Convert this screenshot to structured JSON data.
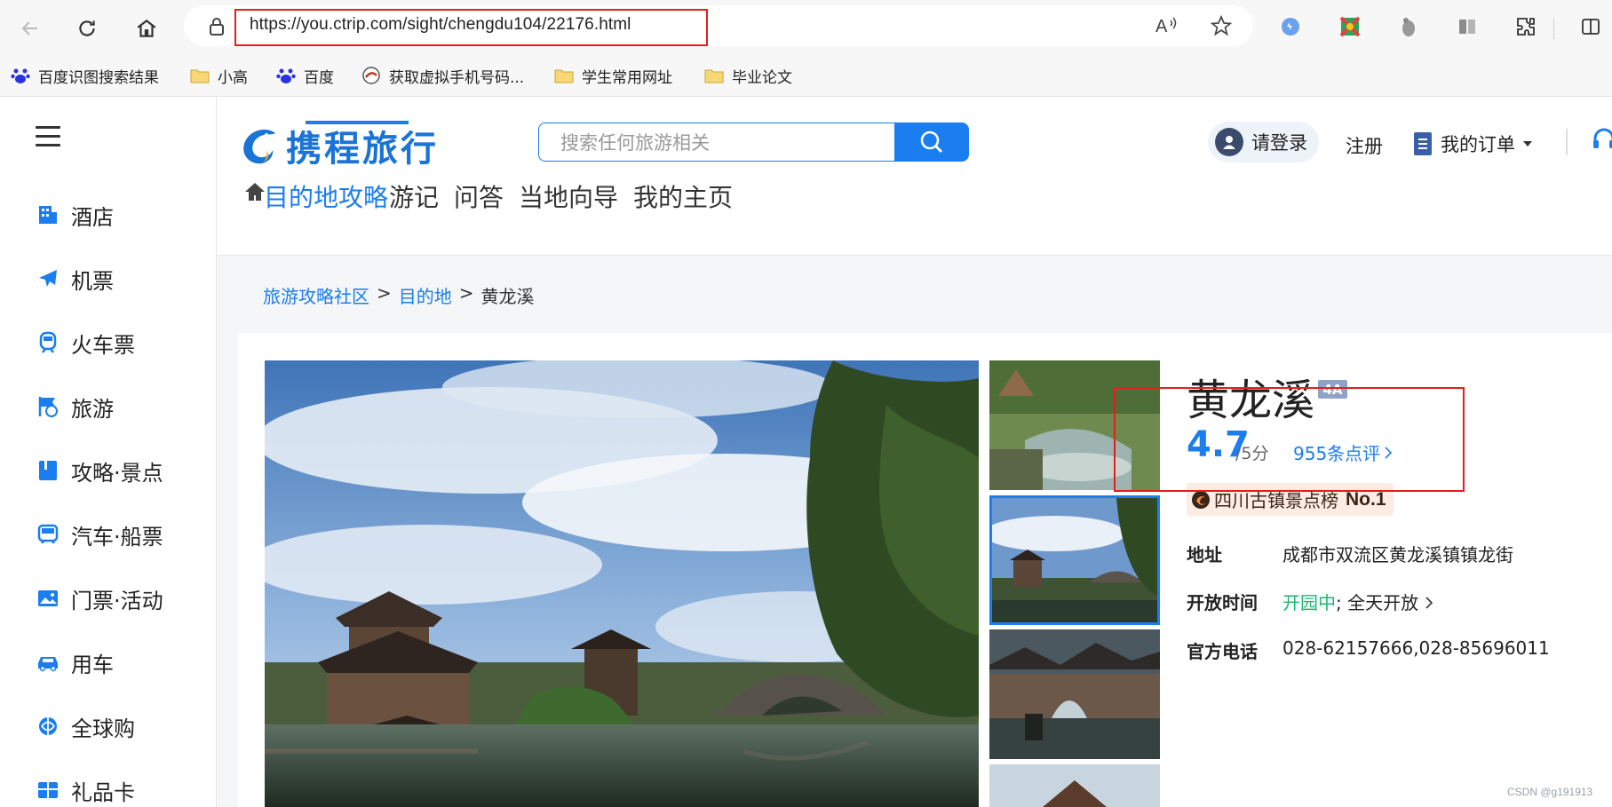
{
  "browser": {
    "url": "https://you.ctrip.com/sight/chengdu104/22176.html",
    "bookmarks": [
      {
        "label": "百度识图搜索结果",
        "icon": "baidu-paw-icon"
      },
      {
        "label": "小高",
        "icon": "folder-icon"
      },
      {
        "label": "百度",
        "icon": "baidu-paw-icon"
      },
      {
        "label": "获取虚拟手机号码...",
        "icon": "site-favicon-icon"
      },
      {
        "label": "学生常用网址",
        "icon": "folder-icon"
      },
      {
        "label": "毕业论文",
        "icon": "folder-icon"
      }
    ]
  },
  "sidebar": {
    "items": [
      {
        "label": "酒店",
        "icon": "hotel-icon"
      },
      {
        "label": "机票",
        "icon": "plane-icon"
      },
      {
        "label": "火车票",
        "icon": "train-icon"
      },
      {
        "label": "旅游",
        "icon": "travel-icon"
      },
      {
        "label": "攻略·景点",
        "icon": "guide-book-icon"
      },
      {
        "label": "汽车·船票",
        "icon": "bus-icon"
      },
      {
        "label": "门票·活动",
        "icon": "ticket-image-icon"
      },
      {
        "label": "用车",
        "icon": "car-icon"
      },
      {
        "label": "全球购",
        "icon": "global-shop-icon"
      },
      {
        "label": "礼品卡",
        "icon": "gift-card-icon"
      }
    ]
  },
  "header": {
    "logo_text": "携程旅行",
    "search_placeholder": "搜索任何旅游相关",
    "login": "请登录",
    "register": "注册",
    "orders": "我的订单",
    "tabs": [
      {
        "label": "目的地攻略",
        "active": true
      },
      {
        "label": "游记",
        "active": false
      },
      {
        "label": "问答",
        "active": false
      },
      {
        "label": "当地向导",
        "active": false
      },
      {
        "label": "我的主页",
        "active": false
      }
    ]
  },
  "breadcrumb": {
    "items": [
      "旅游攻略社区",
      "目的地",
      "黄龙溪"
    ],
    "separator": ">"
  },
  "sight": {
    "name": "黄龙溪",
    "level": "4A",
    "score": "4.7",
    "score_max": "/5分",
    "reviews": "955条点评",
    "rank": "四川古镇景点榜",
    "rank_no": "No.1",
    "address_label": "地址",
    "address": "成都市双流区黄龙溪镇镇龙街",
    "hours_label": "开放时间",
    "hours_status": "开园中",
    "hours_sep": ";",
    "hours_detail": "全天开放",
    "phone_label": "官方电话",
    "phone": "028-62157666,028-85696011"
  },
  "watermark": "CSDN @g191913",
  "colors": {
    "accent": "#1a7df0",
    "open_green": "#22b573",
    "highlight_red": "#e0201c"
  }
}
